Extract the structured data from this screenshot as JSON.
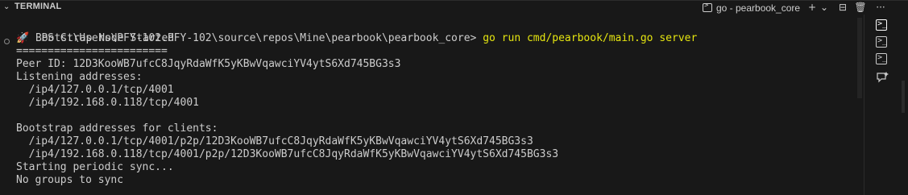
{
  "panel": {
    "title": "TERMINAL"
  },
  "toolbar": {
    "active_tab": "go - pearbook_core",
    "new_terminal": "+",
    "dropdown": "⌄",
    "split": "⊟",
    "kill": "🗑",
    "more": "···"
  },
  "terminal": {
    "prompt": "PS C:\\Users\\PFY-102.PFY-102\\source\\repos\\Mine\\pearbook\\pearbook_core> ",
    "command": "go run cmd/pearbook/main.go server",
    "output": [
      "🚀 Bootstrap Node Started",
      "========================",
      "Peer ID: 12D3KooWB7ufcC8JqyRdaWfK5yKBwVqawciYV4ytS6Xd745BG3s3",
      "Listening addresses:",
      "  /ip4/127.0.0.1/tcp/4001",
      "  /ip4/192.168.0.118/tcp/4001",
      "",
      "Bootstrap addresses for clients:",
      "  /ip4/127.0.0.1/tcp/4001/p2p/12D3KooWB7ufcC8JqyRdaWfK5yKBwVqawciYV4ytS6Xd745BG3s3",
      "  /ip4/192.168.0.118/tcp/4001/p2p/12D3KooWB7ufcC8JqyRdaWfK5yKBwVqawciYV4ytS6Xd745BG3s3",
      "Starting periodic sync...",
      "No groups to sync"
    ]
  },
  "side_terminals": [
    {
      "icon": "terminal-icon",
      "active": true
    },
    {
      "icon": "terminal-icon",
      "active": false
    },
    {
      "icon": "terminal-icon",
      "active": false
    }
  ],
  "colors": {
    "background": "#181818",
    "text": "#cccccc",
    "command": "#e5e510"
  }
}
